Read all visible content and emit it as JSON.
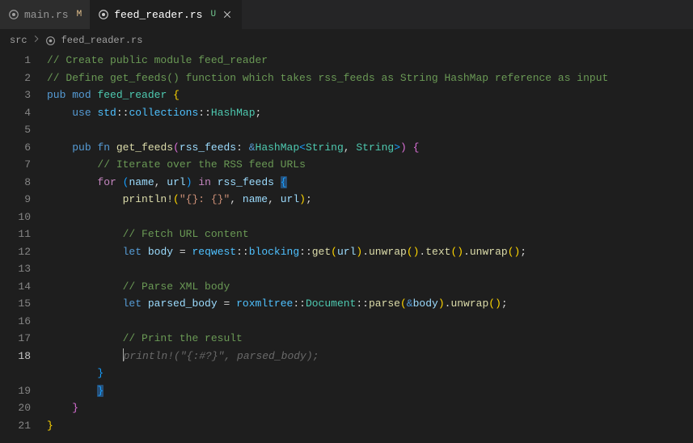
{
  "tabs": [
    {
      "label": "main.rs",
      "status": "M",
      "active": false
    },
    {
      "label": "feed_reader.rs",
      "status": "U",
      "active": true
    }
  ],
  "breadcrumbs": {
    "segments": [
      "src",
      "feed_reader.rs"
    ]
  },
  "icons": {
    "rust": "rust-icon",
    "close": "close-icon",
    "chevron": "chevron-right-icon"
  },
  "code": {
    "line1": "// Create public module feed_reader",
    "line2": "// Define get_feeds() function which takes rss_feeds as String HashMap reference as input",
    "line3": {
      "k1": "pub",
      "k2": "mod",
      "id": "feed_reader",
      "brace": "{"
    },
    "line4": {
      "k1": "use",
      "p1": "std",
      "p2": "collections",
      "p3": "HashMap",
      "semi": ";"
    },
    "line6": {
      "k1": "pub",
      "k2": "fn",
      "fn": "get_feeds",
      "param": "rss_feeds",
      "amp": "&",
      "ty": "HashMap",
      "ty1": "String",
      "ty2": "String",
      "brace": "{"
    },
    "line7": "// Iterate over the RSS feed URLs",
    "line8": {
      "k": "for",
      "lpar": "(",
      "v1": "name",
      "v2": "url",
      "rpar": ")",
      "in": "in",
      "it": "rss_feeds",
      "brace": "{"
    },
    "line9": {
      "fn": "println!",
      "s": "\"{}: {}\"",
      "a1": "name",
      "a2": "url"
    },
    "line11": "// Fetch URL content",
    "line12": {
      "k": "let",
      "v": "body",
      "m1": "reqwest",
      "m2": "blocking",
      "f1": "get",
      "a": "url",
      "f2": "unwrap",
      "f3": "text",
      "f4": "unwrap"
    },
    "line14": "// Parse XML body",
    "line15": {
      "k": "let",
      "v": "parsed_body",
      "m1": "roxmltree",
      "m2": "Document",
      "f1": "parse",
      "amp": "&",
      "a": "body",
      "f2": "unwrap"
    },
    "line17": "// Print the result",
    "line18": "println!(\"{:#?}\", parsed_body);",
    "line19_close": "}",
    "line20_close": "}",
    "line21_close": "}"
  }
}
